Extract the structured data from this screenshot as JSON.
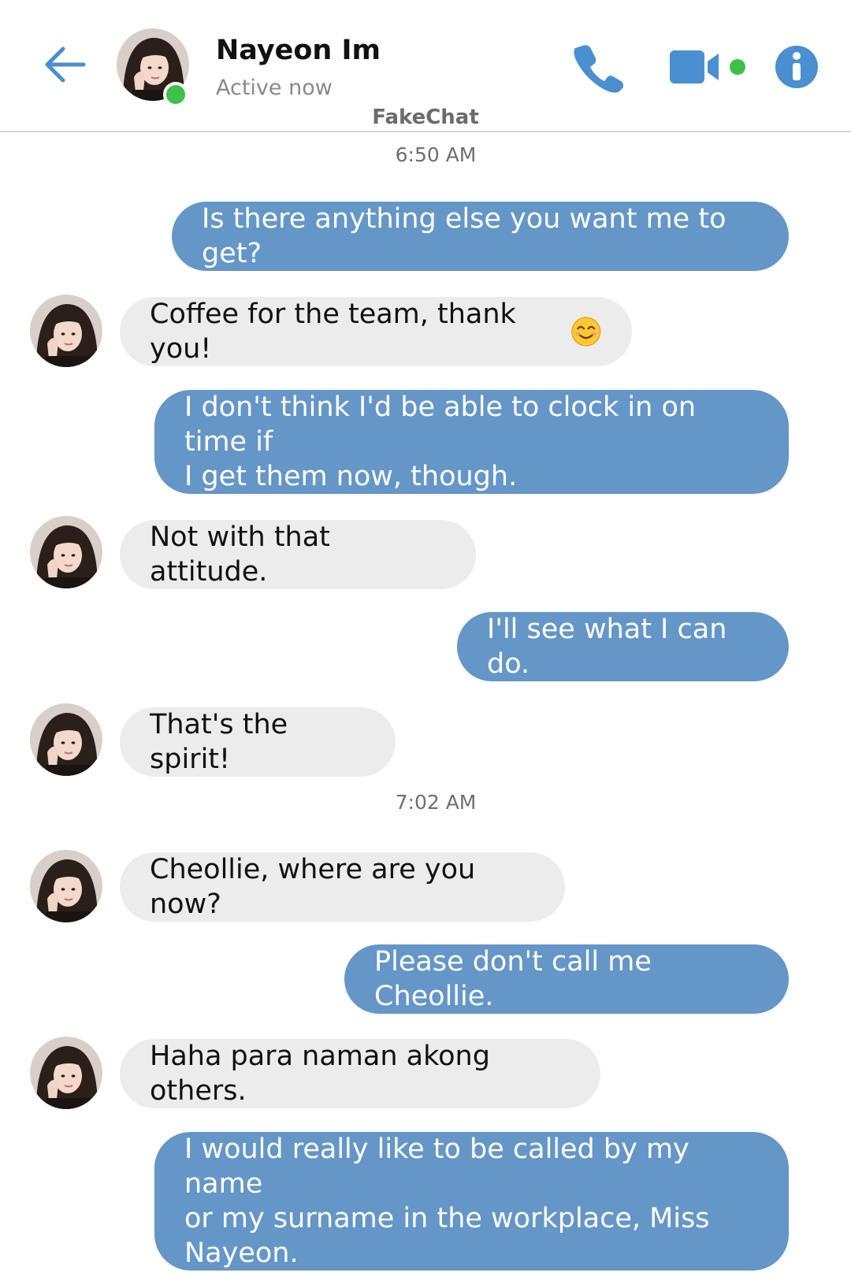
{
  "header": {
    "contact_name": "Nayeon Im",
    "status": "Active now",
    "app_title": "FakeChat"
  },
  "colors": {
    "accent": "#4a8fcf",
    "outgoing_bubble": "#6596c8",
    "incoming_bubble": "#ececec",
    "online": "#3fc04a"
  },
  "icons": [
    "back-arrow-icon",
    "phone-icon",
    "video-call-icon",
    "info-icon"
  ],
  "timestamps": [
    "6:50 AM",
    "7:02 AM"
  ],
  "messages": [
    {
      "from": "me",
      "text": "Is there anything else you want me to get?"
    },
    {
      "from": "them",
      "text": "Coffee for the team, thank you!",
      "emoji": "smiling-face-emoji"
    },
    {
      "from": "me",
      "lines": [
        "I don't think I'd be able to clock in on time if",
        "I get them now, though."
      ]
    },
    {
      "from": "them",
      "text": "Not with that attitude."
    },
    {
      "from": "me",
      "text": "I'll see what I can do."
    },
    {
      "from": "them",
      "text": "That's the spirit!"
    },
    {
      "from": "them",
      "text": "Cheollie, where are you now?"
    },
    {
      "from": "me",
      "text": "Please don't call me Cheollie."
    },
    {
      "from": "them",
      "text": "Haha para naman akong others."
    },
    {
      "from": "me",
      "lines": [
        "I would really like to be called by my name",
        "or my surname in the workplace, Miss",
        "Nayeon."
      ]
    }
  ]
}
